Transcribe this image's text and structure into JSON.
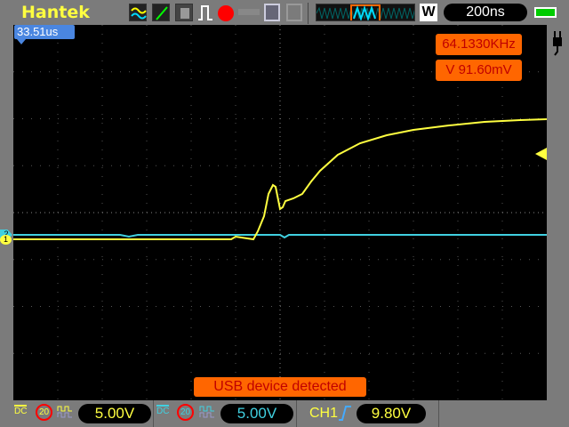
{
  "header": {
    "brand": "Hantek",
    "timebase": "200ns",
    "icons": [
      "dual-wave-icon",
      "xy-mode-icon",
      "persistence-icon",
      "single-trigger-icon",
      "record-icon",
      "key-lock-icon",
      "save-icon",
      "print-icon",
      "memory-position-icon",
      "zoom-w-icon",
      "battery-icon"
    ],
    "zoom_label": "W"
  },
  "screen": {
    "trigger_position": "33.51us",
    "frequency": "64.1330KHz",
    "voltage_measure": "V 91.60mV",
    "message": "USB device detected",
    "ch1_marker": "1",
    "ch2_marker": "2"
  },
  "footer": {
    "ch1": {
      "coupling": "DC",
      "bw_limit": "20",
      "volts_div": "5.00V"
    },
    "ch2": {
      "coupling": "DC",
      "bw_limit": "20",
      "volts_div": "5.00V"
    },
    "trigger": {
      "source": "CH1",
      "level": "9.80V"
    }
  },
  "colors": {
    "ch1": "#ffff40",
    "ch2": "#40d0e0",
    "accent": "#ff6600"
  }
}
